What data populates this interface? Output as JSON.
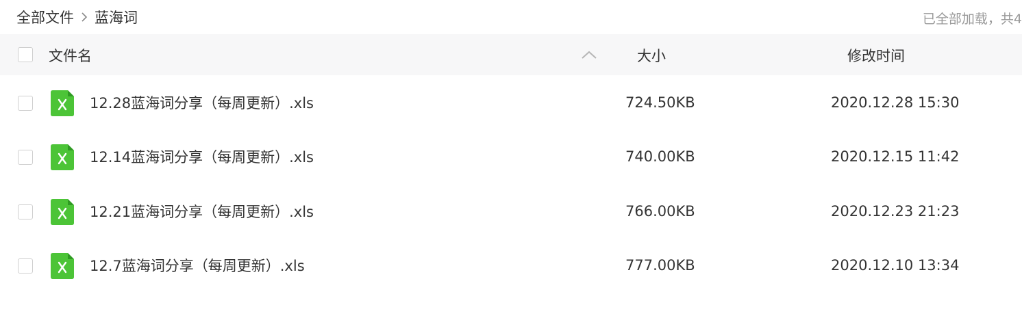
{
  "breadcrumb": {
    "root": "全部文件",
    "current": "蓝海词"
  },
  "status_text": "已全部加载，共4",
  "columns": {
    "name": "文件名",
    "size": "大小",
    "modified": "修改时间"
  },
  "sort": {
    "column": "name",
    "direction": "ascending"
  },
  "files": [
    {
      "name": "12.28蓝海词分享（每周更新）.xls",
      "size": "724.50KB",
      "modified": "2020.12.28 15:30",
      "icon": "excel-file-icon"
    },
    {
      "name": "12.14蓝海词分享（每周更新）.xls",
      "size": "740.00KB",
      "modified": "2020.12.15 11:42",
      "icon": "excel-file-icon"
    },
    {
      "name": "12.21蓝海词分享（每周更新）.xls",
      "size": "766.00KB",
      "modified": "2020.12.23 21:23",
      "icon": "excel-file-icon"
    },
    {
      "name": "12.7蓝海词分享（每周更新）.xls",
      "size": "777.00KB",
      "modified": "2020.12.10 13:34",
      "icon": "excel-file-icon"
    }
  ],
  "colors": {
    "excel_green": "#4cc437",
    "header_bg": "#f7f7f8",
    "muted_text": "#999999"
  }
}
